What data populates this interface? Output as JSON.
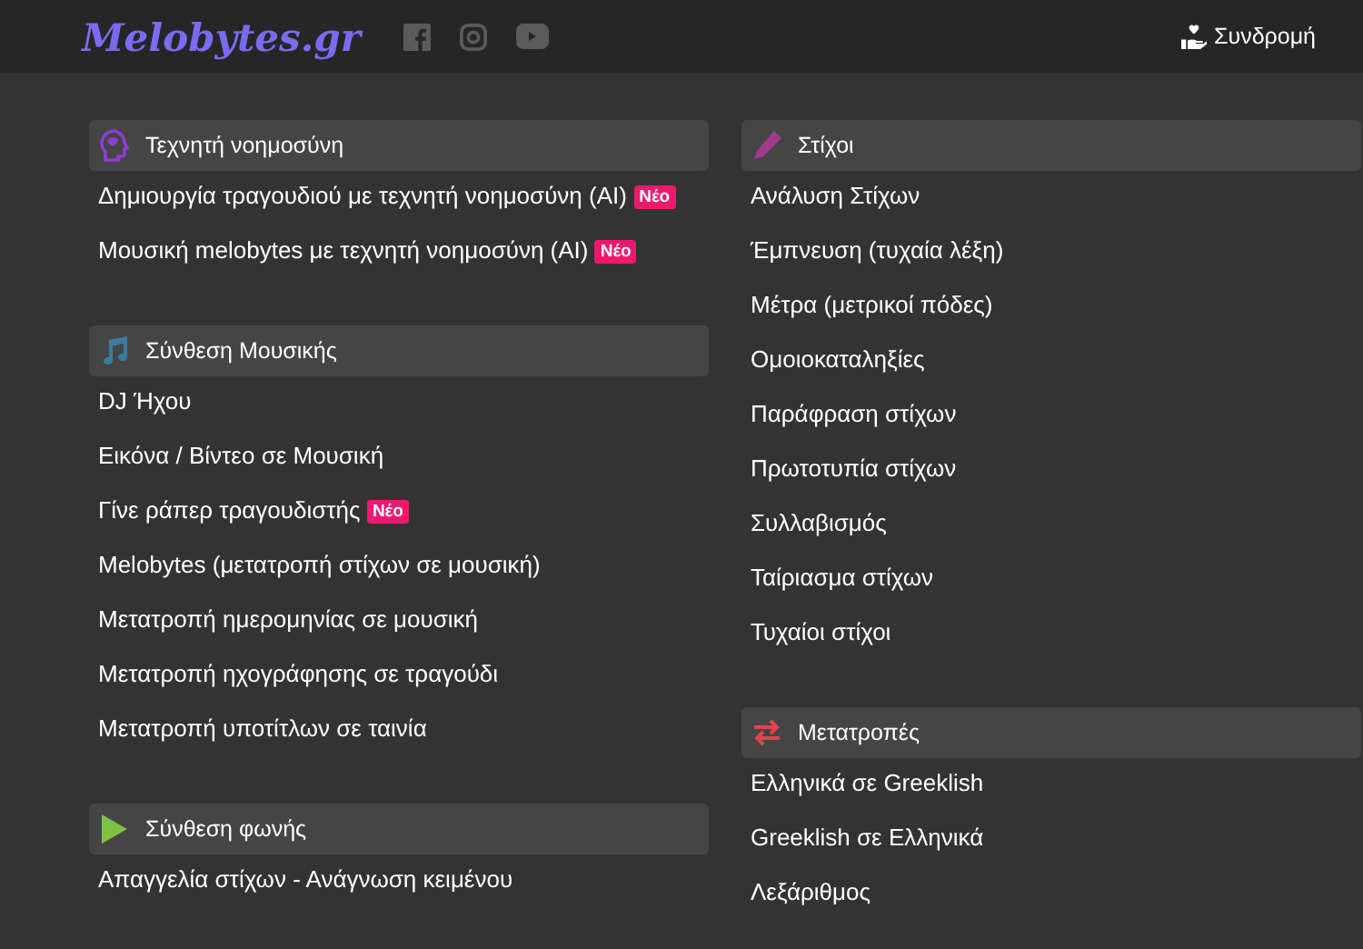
{
  "navbar": {
    "logo": "Melobytes.gr",
    "subscribe": "Συνδρομή"
  },
  "columns": [
    [
      {
        "kind": "ai",
        "title": "Τεχνητή νοημοσύνη",
        "items": [
          {
            "label": "Δημιουργία τραγουδιού με τεχνητή νοημοσύνη (AI)",
            "badge": "Νέο"
          },
          {
            "label": "Μουσική melobytes με τεχνητή νοημοσύνη (AI)",
            "badge": "Νέο"
          }
        ]
      },
      {
        "kind": "music",
        "title": "Σύνθεση Μουσικής",
        "items": [
          {
            "label": "DJ Ήχου"
          },
          {
            "label": "Εικόνα / Βίντεο σε Μουσική"
          },
          {
            "label": "Γίνε ράπερ τραγουδιστής",
            "badge": "Νέο"
          },
          {
            "label": "Melobytes (μετατροπή στίχων σε μουσική)"
          },
          {
            "label": "Μετατροπή ημερομηνίας σε μουσική"
          },
          {
            "label": "Μετατροπή ηχογράφησης σε τραγούδι"
          },
          {
            "label": "Μετατροπή υποτίτλων σε ταινία"
          }
        ]
      },
      {
        "kind": "voice",
        "title": "Σύνθεση φωνής",
        "items": [
          {
            "label": "Απαγγελία στίχων - Ανάγνωση κειμένου"
          }
        ]
      }
    ],
    [
      {
        "kind": "lyrics",
        "title": "Στίχοι",
        "items": [
          {
            "label": "Ανάλυση Στίχων"
          },
          {
            "label": "Έμπνευση (τυχαία λέξη)"
          },
          {
            "label": "Μέτρα (μετρικοί πόδες)"
          },
          {
            "label": "Ομοιοκαταληξίες"
          },
          {
            "label": "Παράφραση στίχων"
          },
          {
            "label": "Πρωτοτυπία στίχων"
          },
          {
            "label": "Συλλαβισμός"
          },
          {
            "label": "Ταίριασμα στίχων"
          },
          {
            "label": "Τυχαίοι στίχοι"
          }
        ]
      },
      {
        "kind": "convert",
        "title": "Μετατροπές",
        "items": [
          {
            "label": "Ελληνικά σε Greeklish"
          },
          {
            "label": "Greeklish σε Ελληνικά"
          },
          {
            "label": "Λεξάριθμος"
          }
        ]
      }
    ]
  ]
}
